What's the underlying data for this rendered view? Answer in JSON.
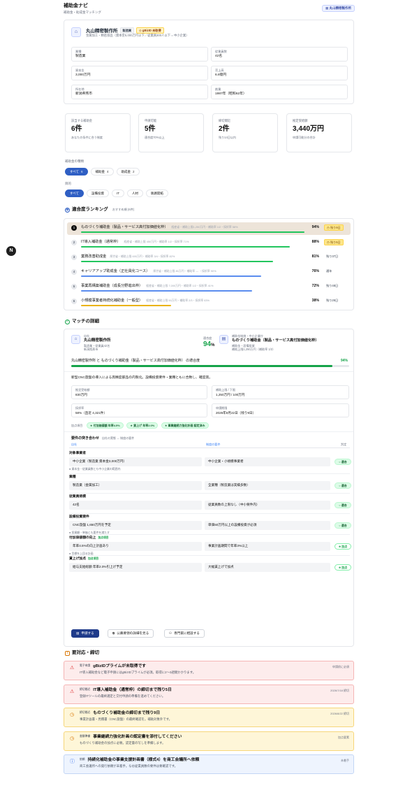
{
  "header": {
    "title": "補助金ナビ",
    "subtitle": "補助金・助成金マッチング",
    "badge": "丸山精密製作所"
  },
  "fab": "N",
  "company": {
    "name": "丸山精密製作所",
    "tag_industry": "製造業",
    "tag_gbiz": "gBizID 未取得",
    "desc": "金属加工・精密部品（資本金5,000万円以下／従業員300人以下 = 中小企業）",
    "fields": [
      {
        "label": "業種",
        "value": "製造業"
      },
      {
        "label": "従業員数",
        "value": "42名"
      },
      {
        "label": "資本金",
        "value": "3,000万円"
      },
      {
        "label": "売上高",
        "value": "6.8億円"
      },
      {
        "label": "所在地",
        "value": "新潟県燕市"
      },
      {
        "label": "創業",
        "value": "1987年（昭和62年）"
      }
    ]
  },
  "stats": [
    {
      "label": "該当する補助金",
      "value": "6件",
      "note": "あなたの条件に合う制度"
    },
    {
      "label": "申請可能",
      "value": "5件",
      "note": "適合度70%以上"
    },
    {
      "label": "締切間近",
      "value": "2件",
      "note": "残り14日以内"
    },
    {
      "label": "推定受給額",
      "value": "3,440万円",
      "note": "申請可能分の合計"
    }
  ],
  "filters": {
    "type_label": "補助金の種類",
    "types": [
      {
        "label": "すべて",
        "count": "6"
      },
      {
        "label": "補助金",
        "count": "4"
      },
      {
        "label": "助成金",
        "count": "2"
      }
    ],
    "purpose_label": "目的",
    "purposes": [
      "すべて",
      "設備投資",
      "IT",
      "人材",
      "販路開拓"
    ]
  },
  "ranking": {
    "title": "適合度ランキング",
    "subtitle": "おすすめ順 (6件)",
    "colors": {
      "green": "#22c55e",
      "blue": "#5b8def",
      "yellow": "#eab308"
    },
    "items": [
      {
        "rank": "1",
        "name": "ものづくり補助金（製品・サービス高付加価値化枠）",
        "meta": "経産省・補助上限1,250万円・補助率 1/2・採択率 58%",
        "pct": "94%",
        "value": 94,
        "deadline": "残り9日",
        "badge": true,
        "color": "#22c55e"
      },
      {
        "rank": "2",
        "name": "IT導入補助金（通常枠）",
        "meta": "経産省・補助上限 450万円・補助率 1/2・採択率 71%",
        "pct": "88%",
        "value": 88,
        "deadline": "残り5日",
        "badge": true,
        "color": "#22c55e"
      },
      {
        "rank": "3",
        "name": "業務改善助成金",
        "meta": "厚労省・補助上限 600万円・補助率 3/4・採択率 82%",
        "pct": "81%",
        "value": 81,
        "deadline": "残り37日",
        "badge": false,
        "color": "#22c55e"
      },
      {
        "rank": "4",
        "name": "キャリアアップ助成金（正社員化コース）",
        "meta": "厚労省・補助上限 80万円・補助率 — ・採択率 90%",
        "pct": "76%",
        "value": 76,
        "deadline": "通年",
        "badge": false,
        "color": "#5b8def"
      },
      {
        "rank": "5",
        "name": "事業再構築補助金（成長分野進出枠）",
        "meta": "経産省・補助上限 7,000万円・補助率 1/2・採択率 41%",
        "pct": "72%",
        "value": 72,
        "deadline": "残り48日",
        "badge": false,
        "color": "#5b8def"
      },
      {
        "rank": "6",
        "name": "小規模事業者持続化補助金（一般型）",
        "meta": "経産省・補助上限 50万円・補助率 2/3・採択率 63%",
        "pct": "38%",
        "value": 38,
        "deadline": "残り26日",
        "badge": false,
        "color": "#eab308"
      }
    ]
  },
  "detail": {
    "title": "マッチの詳細",
    "left_tag": "自社",
    "left_name": "丸山精密製作所",
    "left_sub1": "製造業・従業員42名",
    "left_sub2": "新潟県燕市",
    "score_label": "適合度",
    "score": "94",
    "score_unit": "%",
    "right_tag": "補助金制度・中小企業庁",
    "right_name": "ものづくり補助金（製品・サービス高付加価値化枠）",
    "right_sub1": "補助金・設備投資",
    "right_sub2": "補助上限1,250万円（補助率 1/2）",
    "match_line": "丸山精密製作所 と ものづくり補助金（製品・サービス高付加価値化枠） の適合度",
    "match_pct": "94%",
    "match_value": 94,
    "summary": "新型CNC旋盤の導入による高精度部品の内製化。設備投資要件・業種ともに合致し、確度高。",
    "boxes": [
      {
        "label": "推定受給額",
        "value": "830万円"
      },
      {
        "label": "補助上限 / 下限",
        "value": "1,250万円 / 100万円"
      },
      {
        "label": "採択率",
        "value": "58%（直近 4,321件）"
      },
      {
        "label": "申請期限",
        "value": "2026年8月22日（残り9日）"
      }
    ],
    "bonus_label": "加点項目",
    "bonuses": [
      "付加価値額 年率4.5%",
      "賃上げ 年率2.0%",
      "事業継続力強化計画 認定済み"
    ],
    "req_title": "要件の突き合わせ",
    "req_sub": "自社の実態 ↔ 制度の要件",
    "col_self": "自社",
    "col_rule": "制度の要件",
    "col_judge": "判定",
    "reqs": [
      {
        "name": "対象事業者",
        "tag": "",
        "left": "中小企業（製造業 資本金3,000万円）",
        "right": "中小企業・小規模事業者",
        "judge": "適合",
        "kind": "fit",
        "note": "資本金・従業員数とも中小企業の範囲内"
      },
      {
        "name": "業種",
        "tag": "",
        "left": "製造業（金属加工）",
        "right": "全業種（製造業は実績多数）",
        "judge": "適合",
        "kind": "fit",
        "note": ""
      },
      {
        "name": "従業員規模",
        "tag": "",
        "left": "42名",
        "right": "従業員数の上限なし（中小要件内）",
        "judge": "適合",
        "kind": "fit",
        "note": ""
      },
      {
        "name": "設備投資要件",
        "tag": "",
        "left": "CNC旋盤 1,650万円を予定",
        "right": "単価50万円以上の設備投資が必須",
        "judge": "適合",
        "kind": "fit",
        "note": "投資額・単価とも要件を満たす"
      },
      {
        "name": "付加価値額の向上",
        "tag": "加点項目",
        "left": "年率4.5%の向上計画あり",
        "right": "事業計画期間で年率3%以上",
        "judge": "加点",
        "kind": "plus",
        "note": "目標を上回る計画"
      },
      {
        "name": "賃上げ加点",
        "tag": "加点項目",
        "left": "給与支給総額 年率2.0%引上げ予定",
        "right": "大幅賃上げで加点",
        "judge": "加点",
        "kind": "plus",
        "note": ""
      }
    ],
    "btn_apply": "申請する",
    "btn_guide": "公募要領の詳細を見る",
    "btn_consult": "専門家に相談する"
  },
  "alerts": {
    "title": "要対応・締切",
    "items": [
      {
        "level": "red",
        "icon": "warning-icon",
        "category": "電子申請",
        "title": "gBizIDプライムが未取得です",
        "message": "IT導入補助金など電子申請にはgBizIDプライムが必須。取得に2〜3週間かかります。",
        "when": "申請前に必須"
      },
      {
        "level": "red",
        "icon": "warning-icon",
        "category": "締切間近",
        "title": "IT導入補助金（通常枠）の締切まで残り5日",
        "message": "登録ITツールの最終選定と交付申請の準備を進めてください。",
        "when": "2026/7/18 締切"
      },
      {
        "level": "amber",
        "icon": "clock-icon",
        "category": "締切間近",
        "title": "ものづくり補助金の締切まで残り9日",
        "message": "事業計画書・見積書（CNC旋盤）の最終確認を。補助対象外です。",
        "when": "2026/8/22 締切"
      },
      {
        "level": "amber",
        "icon": "clock-icon",
        "category": "書類準備",
        "title": "事業継続力強化計画の認定書を添付してください",
        "message": "ものづくり補助金の加点に必要。認定書の写しを準備します。",
        "when": "加点要素"
      },
      {
        "level": "blue",
        "icon": "info-icon",
        "category": "依頼",
        "title": "持続化補助金の事業支援計画書（様式4）を商工会議所へ依頼",
        "message": "商工会議所への発行依頼が未着手。なお従業員数の要件は要確認です。",
        "when": "未着手"
      }
    ]
  }
}
